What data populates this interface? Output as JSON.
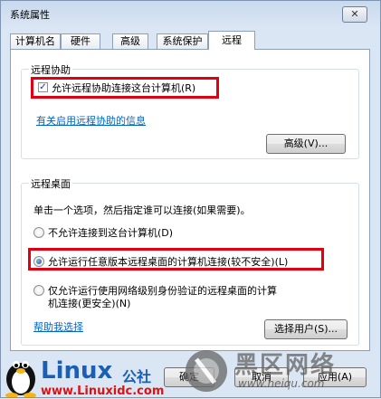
{
  "window": {
    "title": "系统属性",
    "close_symbol": "✕"
  },
  "tabs": [
    {
      "label": "计算机名"
    },
    {
      "label": "硬件"
    },
    {
      "label": "高级"
    },
    {
      "label": "系统保护"
    },
    {
      "label": "远程",
      "active": true
    }
  ],
  "remote_assistance": {
    "group_title": "远程协助",
    "allow_checkbox_label": "允许远程协助连接这台计算机(R)",
    "allow_checked": true,
    "info_link": "有关启用远程协助的信息",
    "advanced_button": "高级(V)..."
  },
  "remote_desktop": {
    "group_title": "远程桌面",
    "instruction": "单击一个选项，然后指定谁可以连接(如果需要)。",
    "options": [
      {
        "label": "不允许连接到这台计算机(D)",
        "selected": false
      },
      {
        "label": "允许运行任意版本远程桌面的计算机连接(较不安全)(L)",
        "selected": true
      },
      {
        "label_line1": "仅允许运行使用网络级别身份验证的远程桌面的计算",
        "label_line2": "机连接(更安全)(N)",
        "selected": false
      }
    ],
    "help_link": "帮助我选择",
    "select_users_button": "选择用户(S)..."
  },
  "footer": {
    "ok_button": "确定",
    "cancel_button": "取消",
    "apply_button": "应用(A)"
  },
  "watermarks": {
    "left_brand": "Linux",
    "left_brand_suffix": "公社",
    "left_url": "www.Linuxidc.com",
    "right_brand": "黑区网络",
    "right_url": "www.heiqu.com"
  },
  "colors": {
    "highlight": "#e0000f",
    "link": "#0066cc",
    "watermark_blue": "#1a5fb4"
  }
}
